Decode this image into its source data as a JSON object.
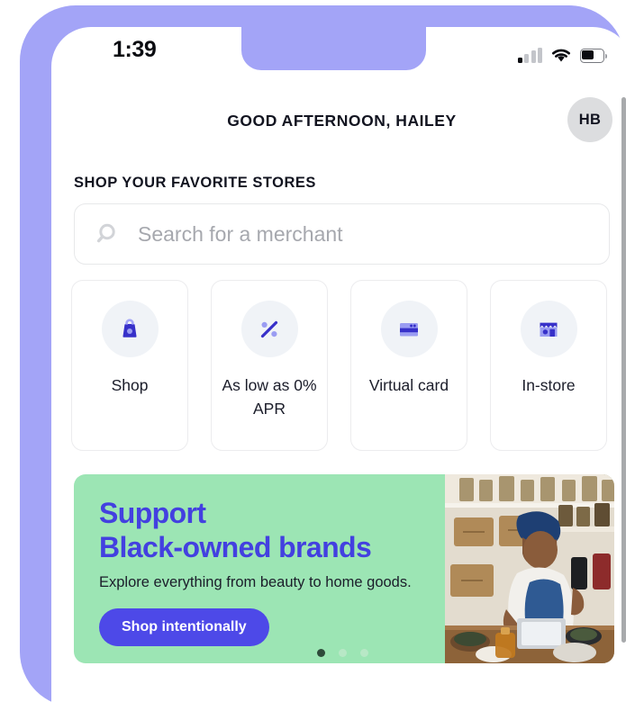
{
  "device": {
    "frame_color": "#a3a4f7",
    "status_bar": {
      "time": "1:39",
      "signal_icon": "cellular-signal-icon",
      "wifi_icon": "wifi-icon",
      "battery_icon": "battery-icon",
      "battery_level_pct": 52
    }
  },
  "header": {
    "greeting": "GOOD AFTERNOON, HAILEY",
    "avatar_initials": "HB"
  },
  "section": {
    "label": "SHOP YOUR FAVORITE STORES"
  },
  "search": {
    "placeholder": "Search for a merchant",
    "value": "",
    "icon": "search-icon"
  },
  "quick_actions": [
    {
      "label": "Shop",
      "icon": "shopping-bag-icon"
    },
    {
      "label": "As low as 0% APR",
      "icon": "percent-icon"
    },
    {
      "label": "Virtual card",
      "icon": "credit-card-icon"
    },
    {
      "label": "In-store",
      "icon": "storefront-icon"
    }
  ],
  "promo": {
    "headline_line1": "Support",
    "headline_line2": "Black-owned brands",
    "subtitle": "Explore everything from beauty to home goods.",
    "cta_label": "Shop intentionally",
    "background_color": "#9ce5b4",
    "headline_color": "#4340e0",
    "cta_color": "#4d49e8",
    "dots_total": 3,
    "dot_active_index": 0,
    "image_alt": "merchant working at shop counter"
  },
  "theme": {
    "accent_purple": "#4340e0",
    "icon_light_purple": "#a3a4f7",
    "icon_tile_bg": "#f0f3f7",
    "text_dark": "#121420",
    "text_muted": "#a6a8ae"
  }
}
